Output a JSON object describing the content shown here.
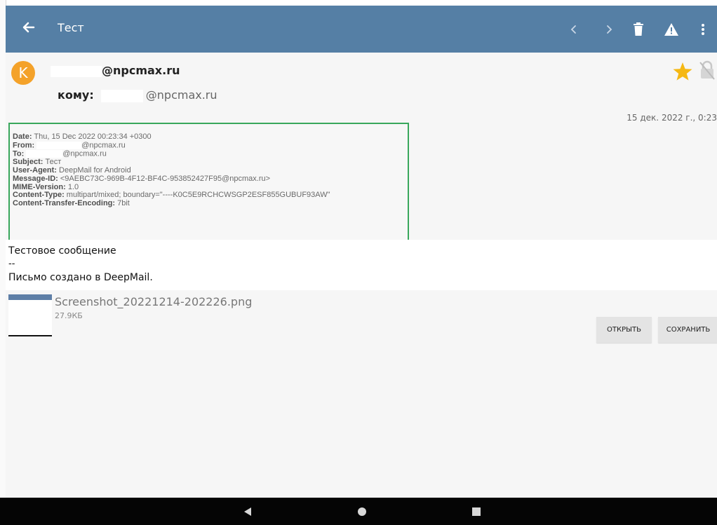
{
  "appbar": {
    "title": "Тест",
    "icons": [
      "back-arrow-icon",
      "chevron-left-icon",
      "chevron-right-icon",
      "trash-icon",
      "warning-icon",
      "more-vert-icon"
    ],
    "color": "#557fa5"
  },
  "message": {
    "avatar_letter": "K",
    "avatar_color": "#f4a22a",
    "sender_domain": "@npcmax.ru",
    "to_label": "кому:",
    "to_domain": "@npcmax.ru",
    "date": "15 дек. 2022 г., 0:23",
    "starred": true
  },
  "headers": {
    "date_label": "Date:",
    "date_value": "Thu, 15 Dec 2022 00:23:34 +0300",
    "from_label": "From:",
    "from_value": "@npcmax.ru",
    "to_label": "To:",
    "to_value": "@npcmax.ru",
    "subject_label": "Subject:",
    "subject_value": "Тест",
    "ua_label": "User-Agent:",
    "ua_value": "DeepMail for Android",
    "msgid_label": "Message-ID:",
    "msgid_value": "<9AEBC73C-969B-4F12-BF4C-953852427F95@npcmax.ru>",
    "mime_label": "MIME-Version:",
    "mime_value": "1.0",
    "ctype_label": "Content-Type:",
    "ctype_value": "multipart/mixed; boundary=\"----K0C5E9RCHCWSGP2ESF855GUBUF93AW\"",
    "cte_label": "Content-Transfer-Encoding:",
    "cte_value": "7bit",
    "highlight_color": "#39a75c"
  },
  "body": {
    "line1": "Тестовое сообщение",
    "line2": "--",
    "line3": "Письмо создано в DeepMail."
  },
  "attachment": {
    "filename": "Screenshot_20221214-202226.png",
    "size": "27.9КБ",
    "open_label": "ОТКРЫТЬ",
    "save_label": "СОХРАНИТЬ"
  },
  "navbar": {
    "icons": [
      "back-triangle-icon",
      "home-circle-icon",
      "recents-square-icon"
    ]
  }
}
